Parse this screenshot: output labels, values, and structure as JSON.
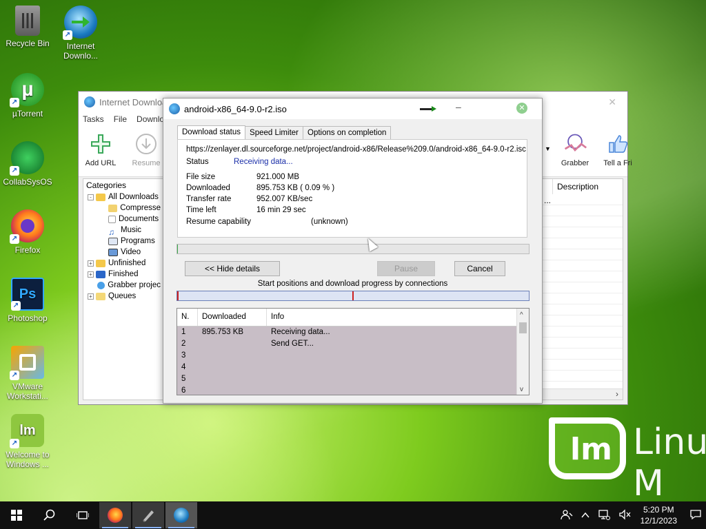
{
  "desktop": {
    "icons": [
      {
        "label": "Recycle Bin",
        "icon": "recycle-bin-icon"
      },
      {
        "label": "Internet Downlo...",
        "icon": "idm-icon"
      },
      {
        "label": "µTorrent",
        "icon": "utorrent-icon"
      },
      {
        "label": "CollabSysOS",
        "icon": "collabsysos-icon"
      },
      {
        "label": "Firefox",
        "icon": "firefox-icon"
      },
      {
        "label": "Photoshop",
        "icon": "photoshop-icon"
      },
      {
        "label": "VMware Workstati...",
        "icon": "vmware-icon"
      },
      {
        "label": "Welcome to Windows ...",
        "icon": "linux-mint-icon"
      }
    ],
    "wallpaper_text": "Linux M"
  },
  "main_window": {
    "title": "Internet Downloa",
    "menu": [
      "Tasks",
      "File",
      "Downlo"
    ],
    "toolbar": [
      {
        "label": "Add URL",
        "icon": "plus-icon"
      },
      {
        "label": "Resume",
        "icon": "download-arrow-icon"
      },
      {
        "label": "Grabber",
        "icon": "grabber-icon"
      },
      {
        "label": "Tell a Fri",
        "icon": "thumbs-up-icon"
      }
    ],
    "categories_title": "Categories",
    "categories": [
      {
        "label": "All Downloads",
        "expander": "-"
      },
      {
        "label": "Compresse",
        "expander": ""
      },
      {
        "label": "Documents",
        "expander": ""
      },
      {
        "label": "Music",
        "expander": ""
      },
      {
        "label": "Programs",
        "expander": ""
      },
      {
        "label": "Video",
        "expander": ""
      },
      {
        "label": "Unfinished",
        "expander": "+"
      },
      {
        "label": "Finished",
        "expander": "+"
      },
      {
        "label": "Grabber projec",
        "expander": ""
      },
      {
        "label": "Queues",
        "expander": "+"
      }
    ],
    "list_headers": [
      "y...",
      "Description"
    ],
    "first_row_cell": "..."
  },
  "dialog": {
    "title": "android-x86_64-9.0-r2.iso",
    "tabs": [
      "Download status",
      "Speed Limiter",
      "Options on completion"
    ],
    "url": "https://zenlayer.dl.sourceforge.net/project/android-x86/Release%209.0/android-x86_64-9.0-r2.isc",
    "status_label": "Status",
    "status_value": "Receiving data...",
    "file_size_label": "File size",
    "file_size_value": "921.000  MB",
    "downloaded_label": "Downloaded",
    "downloaded_value": "895.753  KB  ( 0.09 % )",
    "transfer_rate_label": "Transfer rate",
    "transfer_rate_value": "952.007  KB/sec",
    "time_left_label": "Time left",
    "time_left_value": "16 min 29 sec",
    "resume_label": "Resume capability",
    "resume_value": "(unknown)",
    "progress_fraction": 0.0009,
    "hide_details_button": "<< Hide details",
    "pause_button": "Pause",
    "cancel_button": "Cancel",
    "connections_label": "Start positions and download progress by connections",
    "connection_table": {
      "headers": [
        "N.",
        "Downloaded",
        "Info"
      ],
      "rows": [
        {
          "n": "1",
          "downloaded": "895.753  KB",
          "info": "Receiving data..."
        },
        {
          "n": "2",
          "downloaded": "",
          "info": "Send GET..."
        },
        {
          "n": "3",
          "downloaded": "",
          "info": ""
        },
        {
          "n": "4",
          "downloaded": "",
          "info": ""
        },
        {
          "n": "5",
          "downloaded": "",
          "info": ""
        },
        {
          "n": "6",
          "downloaded": "",
          "info": ""
        }
      ]
    }
  },
  "taskbar": {
    "time": "5:20 PM",
    "date": "12/1/2023",
    "apps": [
      "firefox-icon",
      "pen-tool-icon",
      "idm-icon"
    ]
  }
}
